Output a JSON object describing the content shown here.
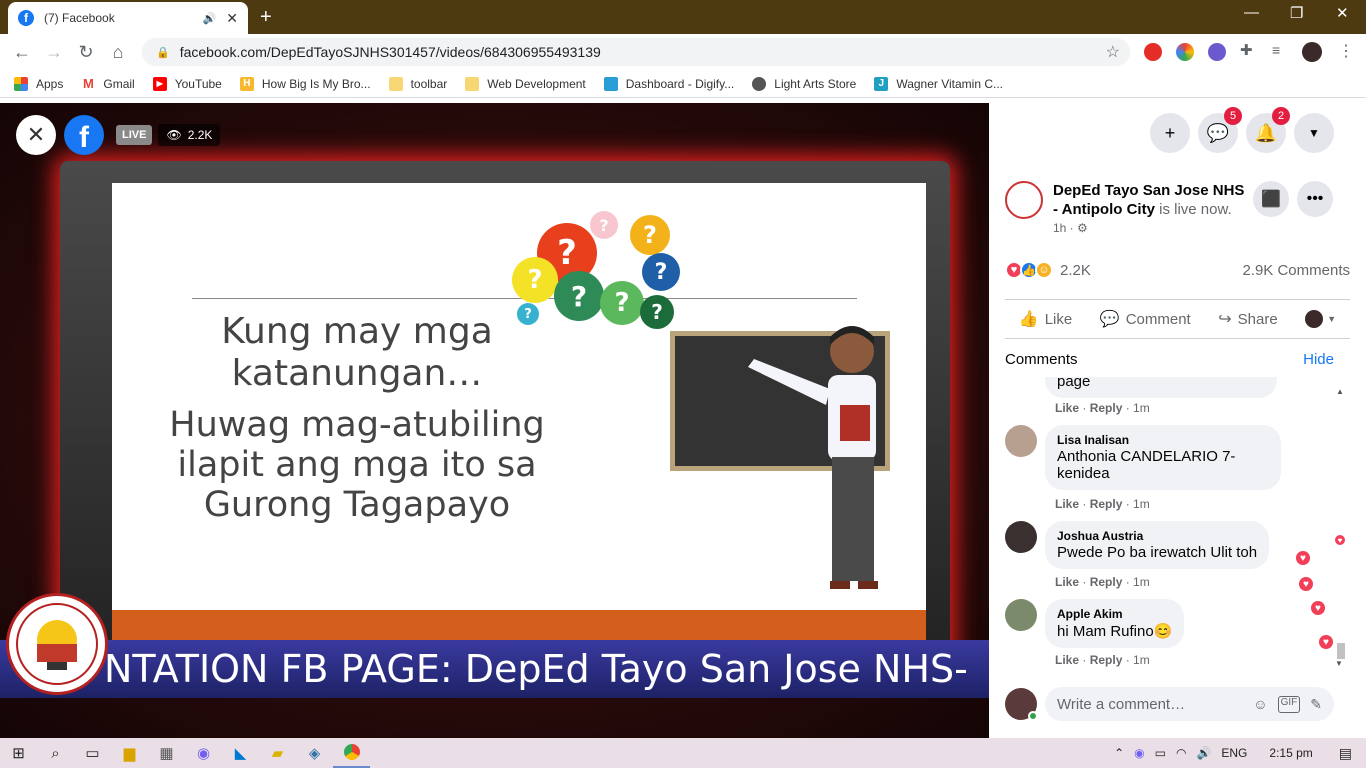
{
  "browser": {
    "tab_title": "(7) Facebook",
    "url": "facebook.com/DepEdTayoSJNHS301457/videos/684306955493139",
    "bookmarks": [
      "Apps",
      "Gmail",
      "YouTube",
      "How Big Is My Bro...",
      "toolbar",
      "Web Development",
      "Dashboard - Digify...",
      "Light Arts Store",
      "Wagner Vitamin C..."
    ]
  },
  "video": {
    "live_label": "LIVE",
    "viewers": "2.2K",
    "slide_line1": "Kung may mga katanungan…",
    "slide_line2": "Huwag mag-atubiling ilapit ang mga ito sa Gurong Tagapayo",
    "ticker": "NTATION     FB PAGE: DepEd Tayo San Jose NHS-",
    "logo_text": "SAN JOSE NATIONAL HIGH SCHOOL 1999 Antipolo City"
  },
  "header": {
    "messenger_badge": "5",
    "notifications_badge": "2"
  },
  "post": {
    "page_name": "DepEd Tayo San Jose NHS - Antipolo City",
    "status": "is live now.",
    "time": "1h ·",
    "reactions_count": "2.2K",
    "comments_count": "2.9K Comments",
    "actions": {
      "like": "Like",
      "comment": "Comment",
      "share": "Share"
    }
  },
  "comments_section": {
    "title": "Comments",
    "hide_label": "Hide",
    "partial_text": "page",
    "meta_like": "Like",
    "meta_reply": "Reply",
    "meta_sep": " · ",
    "items": [
      {
        "name": "Lisa Inalisan",
        "text": "Anthonia CANDELARIO 7- kenidea",
        "time": "1m"
      },
      {
        "name": "Joshua Austria",
        "text": "Pwede Po ba irewatch Ulit toh",
        "time": "1m"
      },
      {
        "name": "Apple Akim",
        "text": "hi Mam Rufino😊",
        "time": "1m"
      }
    ],
    "partial_time": "1m",
    "write_placeholder": "Write a comment…"
  },
  "taskbar": {
    "language": "ENG",
    "time": "2:15 pm"
  }
}
